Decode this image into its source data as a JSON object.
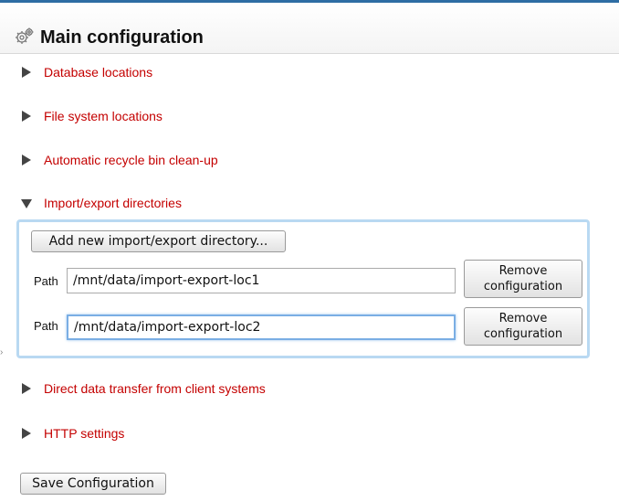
{
  "header": {
    "title": "Main configuration",
    "icon": "gear-icon"
  },
  "sections": [
    {
      "label": "Database locations",
      "expanded": false
    },
    {
      "label": "File system locations",
      "expanded": false
    },
    {
      "label": "Automatic recycle bin clean-up",
      "expanded": false
    },
    {
      "label": "Import/export directories",
      "expanded": true
    },
    {
      "label": "Direct data transfer from client systems",
      "expanded": false
    },
    {
      "label": "HTTP settings",
      "expanded": false
    }
  ],
  "import_export": {
    "add_button_label": "Add new import/export directory...",
    "entries": [
      {
        "path_label": "Path",
        "value": "/mnt/data/import-export-loc1",
        "remove_label_1": "Remove",
        "remove_label_2": "configuration"
      },
      {
        "path_label": "Path",
        "value": "/mnt/data/import-export-loc2",
        "remove_label_1": "Remove",
        "remove_label_2": "configuration"
      }
    ]
  },
  "footer": {
    "save_label": "Save Configuration"
  },
  "colors": {
    "section_link": "#c40000",
    "accent_bar": "#2e6da4",
    "panel_border": "#b9d9f2"
  }
}
